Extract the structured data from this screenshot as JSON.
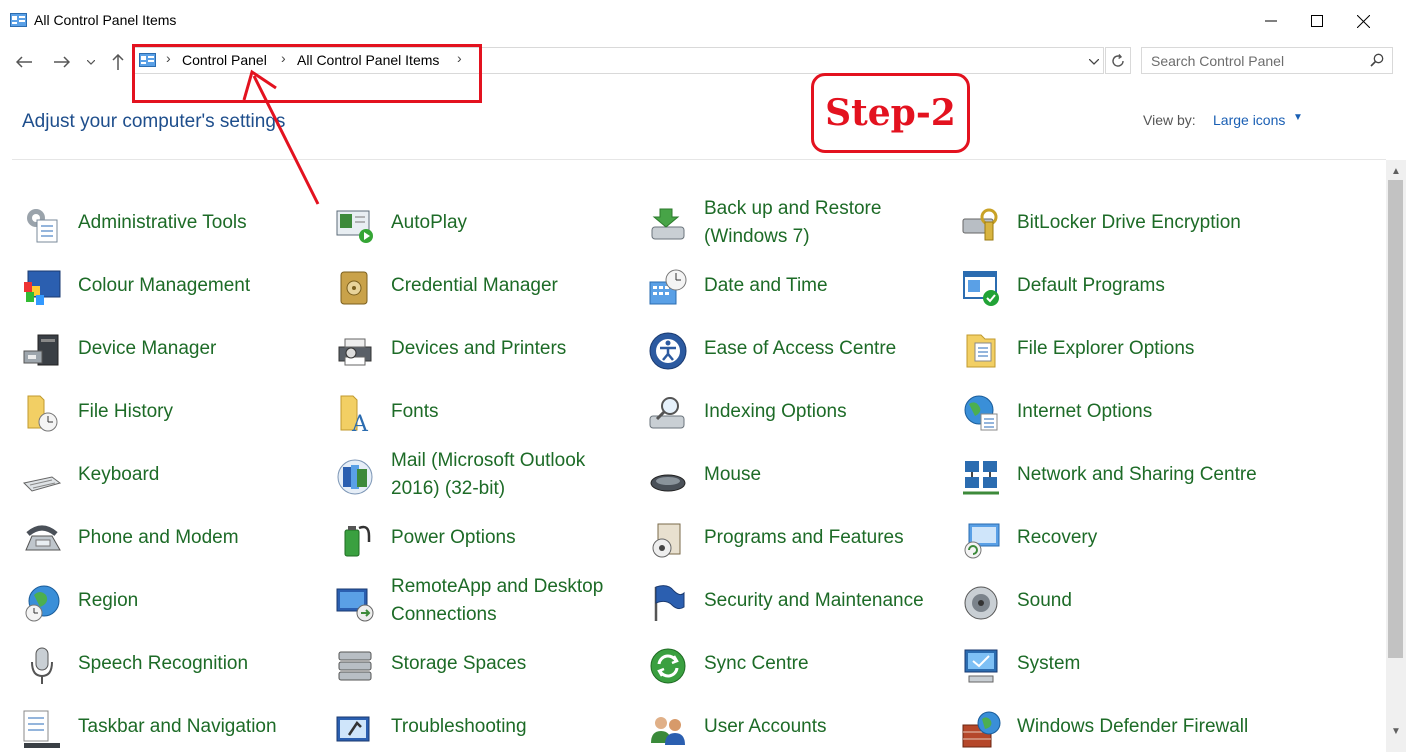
{
  "window": {
    "title": "All Control Panel Items"
  },
  "address": {
    "breadcrumbs": [
      "Control Panel",
      "All Control Panel Items"
    ],
    "search_placeholder": "Search Control Panel"
  },
  "annotations": {
    "step": "Step-2"
  },
  "header": {
    "heading": "Adjust your computer's settings",
    "view_by_label": "View by:",
    "view_by_value": "Large icons"
  },
  "items": [
    {
      "label": "Administrative Tools",
      "icon": "admin-tools-icon"
    },
    {
      "label": "AutoPlay",
      "icon": "autoplay-icon"
    },
    {
      "label": "Back up and Restore (Windows 7)",
      "icon": "backup-restore-icon"
    },
    {
      "label": "BitLocker Drive Encryption",
      "icon": "bitlocker-icon"
    },
    {
      "label": "Colour Management",
      "icon": "colour-management-icon"
    },
    {
      "label": "Credential Manager",
      "icon": "credential-manager-icon"
    },
    {
      "label": "Date and Time",
      "icon": "date-time-icon"
    },
    {
      "label": "Default Programs",
      "icon": "default-programs-icon"
    },
    {
      "label": "Device Manager",
      "icon": "device-manager-icon"
    },
    {
      "label": "Devices and Printers",
      "icon": "devices-printers-icon"
    },
    {
      "label": "Ease of Access Centre",
      "icon": "ease-of-access-icon"
    },
    {
      "label": "File Explorer Options",
      "icon": "file-explorer-options-icon"
    },
    {
      "label": "File History",
      "icon": "file-history-icon"
    },
    {
      "label": "Fonts",
      "icon": "fonts-icon"
    },
    {
      "label": "Indexing Options",
      "icon": "indexing-options-icon"
    },
    {
      "label": "Internet Options",
      "icon": "internet-options-icon"
    },
    {
      "label": "Keyboard",
      "icon": "keyboard-icon"
    },
    {
      "label": "Mail (Microsoft Outlook 2016) (32-bit)",
      "icon": "mail-icon"
    },
    {
      "label": "Mouse",
      "icon": "mouse-icon"
    },
    {
      "label": "Network and Sharing Centre",
      "icon": "network-sharing-icon"
    },
    {
      "label": "Phone and Modem",
      "icon": "phone-modem-icon"
    },
    {
      "label": "Power Options",
      "icon": "power-options-icon"
    },
    {
      "label": "Programs and Features",
      "icon": "programs-features-icon"
    },
    {
      "label": "Recovery",
      "icon": "recovery-icon"
    },
    {
      "label": "Region",
      "icon": "region-icon"
    },
    {
      "label": "RemoteApp and Desktop Connections",
      "icon": "remoteapp-icon"
    },
    {
      "label": "Security and Maintenance",
      "icon": "security-maintenance-icon"
    },
    {
      "label": "Sound",
      "icon": "sound-icon"
    },
    {
      "label": "Speech Recognition",
      "icon": "speech-recognition-icon"
    },
    {
      "label": "Storage Spaces",
      "icon": "storage-spaces-icon"
    },
    {
      "label": "Sync Centre",
      "icon": "sync-centre-icon"
    },
    {
      "label": "System",
      "icon": "system-icon"
    },
    {
      "label": "Taskbar and Navigation",
      "icon": "taskbar-navigation-icon"
    },
    {
      "label": "Troubleshooting",
      "icon": "troubleshooting-icon"
    },
    {
      "label": "User Accounts",
      "icon": "user-accounts-icon"
    },
    {
      "label": "Windows Defender Firewall",
      "icon": "firewall-icon"
    }
  ],
  "colors": {
    "link_green": "#1d6b27",
    "heading_blue": "#1e4e8c",
    "annotation_red": "#e3121f"
  }
}
